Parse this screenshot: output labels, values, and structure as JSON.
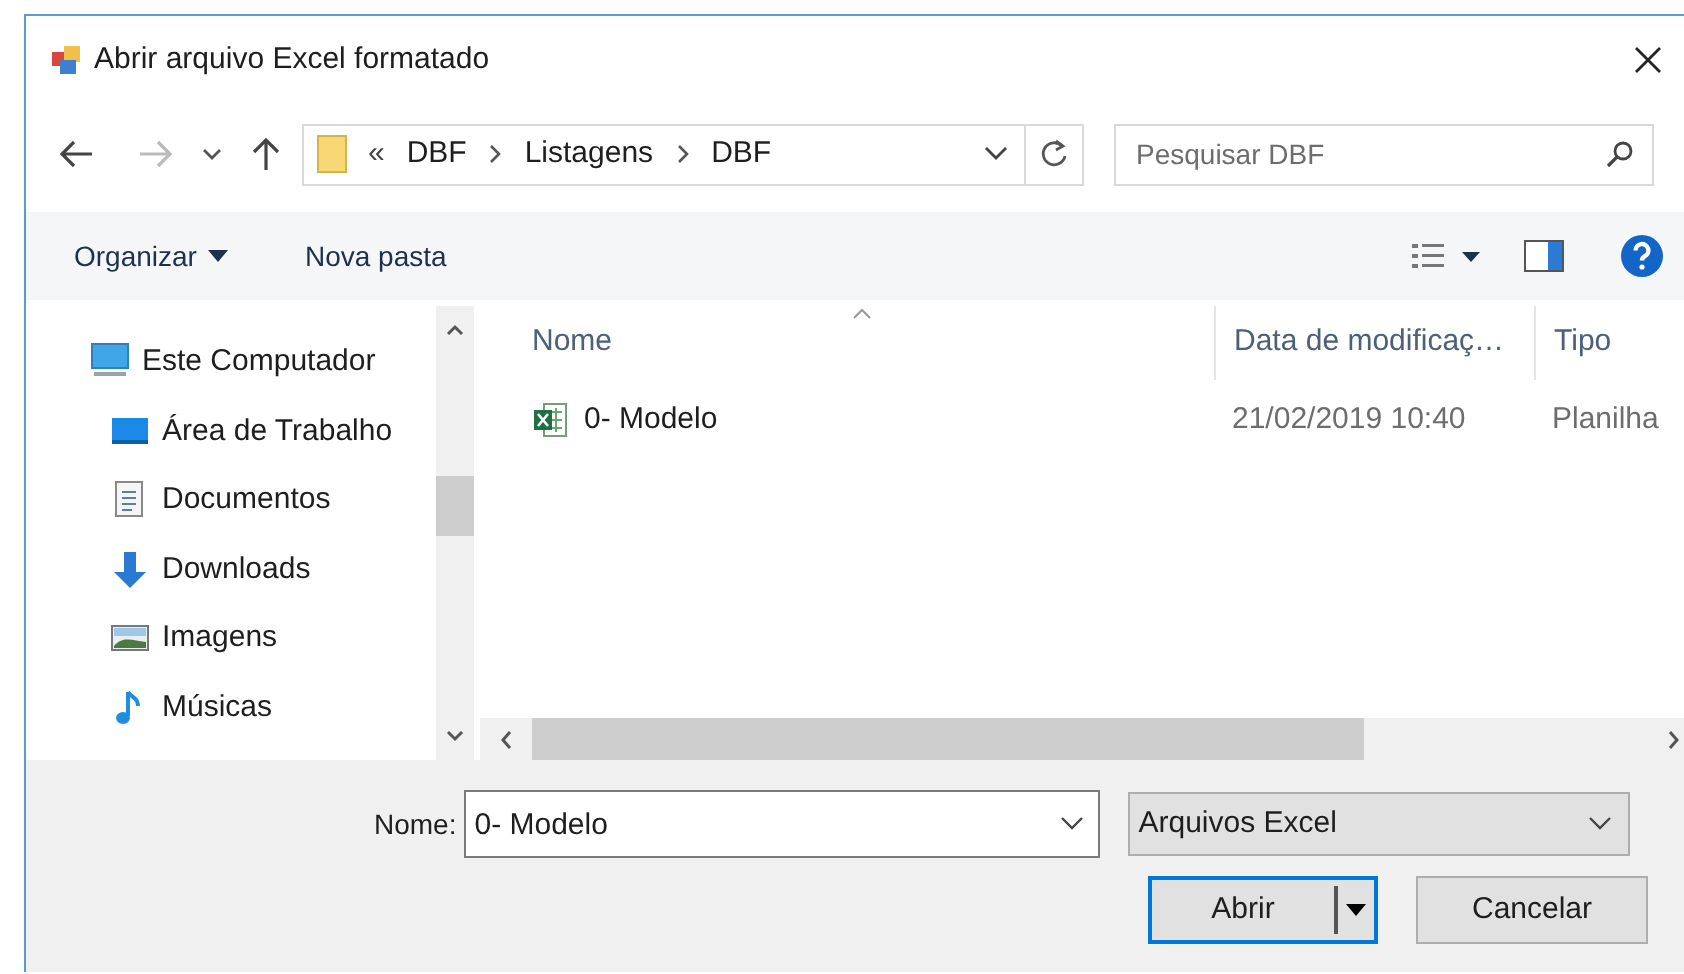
{
  "window": {
    "title": "Abrir arquivo Excel formatado"
  },
  "address": {
    "overflow_mark": "«",
    "segments": [
      "DBF",
      "Listagens",
      "DBF"
    ]
  },
  "search": {
    "placeholder": "Pesquisar DBF"
  },
  "toolbar": {
    "organize": "Organizar",
    "new_folder": "Nova pasta"
  },
  "sidebar": {
    "items": [
      {
        "label": "Este Computador",
        "kind": "computer",
        "children": [
          {
            "label": "Área de Trabalho",
            "kind": "desktop"
          },
          {
            "label": "Documentos",
            "kind": "documents"
          },
          {
            "label": "Downloads",
            "kind": "downloads"
          },
          {
            "label": "Imagens",
            "kind": "images"
          },
          {
            "label": "Músicas",
            "kind": "music"
          }
        ]
      }
    ]
  },
  "table": {
    "columns": [
      "Nome",
      "Data de modificaç…",
      "Tipo"
    ],
    "rows": [
      {
        "kind": "excel",
        "cells": [
          "0- Modelo",
          "21/02/2019 10:40",
          "Planilha"
        ]
      }
    ]
  },
  "footer": {
    "name_label": "Nome:",
    "name_value": "0- Modelo",
    "file_type": "Arquivos Excel",
    "buttons": [
      {
        "label": "Abrir",
        "focused": true,
        "split": true
      },
      {
        "label": "Cancelar",
        "focused": false,
        "split": false
      }
    ]
  }
}
